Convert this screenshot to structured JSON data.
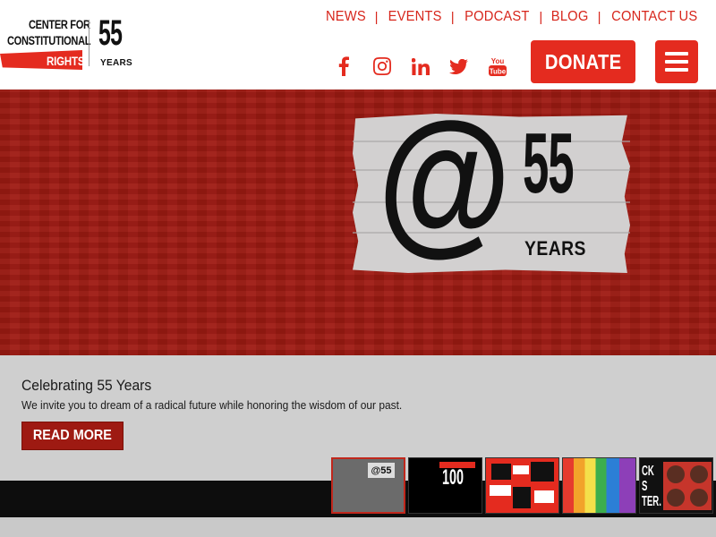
{
  "logo": {
    "line1": "CENTER FOR",
    "line2": "CONSTITUTIONAL",
    "line3": "RIGHTS",
    "anniversary_number": "55",
    "anniversary_label": "YEARS"
  },
  "topnav": {
    "items": [
      "NEWS",
      "EVENTS",
      "PODCAST",
      "BLOG",
      "CONTACT US"
    ],
    "separator": "|"
  },
  "social": {
    "icons": [
      "facebook-icon",
      "instagram-icon",
      "linkedin-icon",
      "twitter-icon",
      "youtube-icon"
    ],
    "youtube_text_top": "You",
    "youtube_text_bottom": "Tube"
  },
  "header": {
    "donate_label": "DONATE",
    "menu_icon": "hamburger-menu-icon"
  },
  "hero": {
    "art_symbol": "@",
    "art_number": "55",
    "art_label": "YEARS"
  },
  "slide": {
    "title": "Celebrating 55 Years",
    "description": "We invite you to dream of a radical future while honoring the wisdom of our past.",
    "cta_label": "READ MORE"
  },
  "thumbnails": {
    "t1_text": "@55",
    "t2_text": "100",
    "t5_text_1": "CK",
    "t5_text_2": "S",
    "t5_text_3": "TER."
  },
  "colors": {
    "brand_red": "#e42b1f",
    "hero_red": "#9e1a12",
    "caption_bg": "#cfcfcf"
  }
}
